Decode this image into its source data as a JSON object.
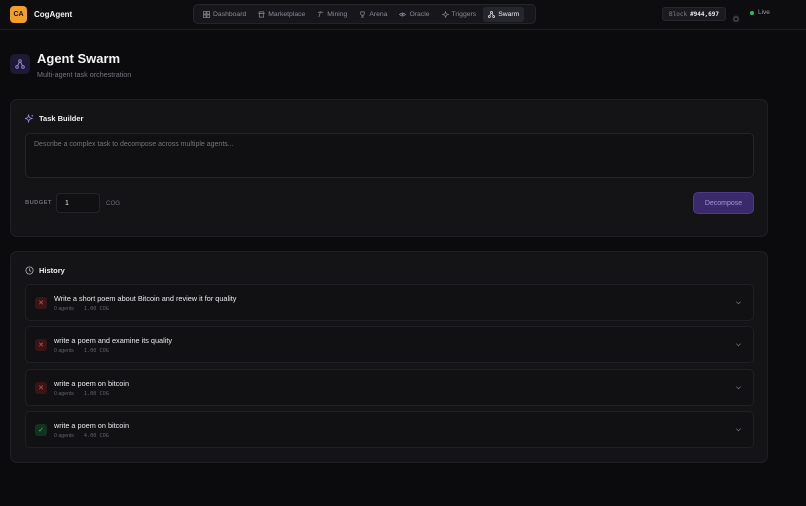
{
  "app": {
    "logo_text": "CA",
    "name": "CogAgent"
  },
  "nav": [
    {
      "label": "Dashboard",
      "icon": "grid-icon",
      "active": false
    },
    {
      "label": "Marketplace",
      "icon": "store-icon",
      "active": false
    },
    {
      "label": "Mining",
      "icon": "pickaxe-icon",
      "active": false
    },
    {
      "label": "Arena",
      "icon": "trophy-icon",
      "active": false
    },
    {
      "label": "Oracle",
      "icon": "eye-icon",
      "active": false
    },
    {
      "label": "Triggers",
      "icon": "sparkle-icon",
      "active": false
    },
    {
      "label": "Swarm",
      "icon": "network-icon",
      "active": true
    }
  ],
  "status": {
    "block_label": "Block",
    "block_value": "#944,697",
    "live_label": "Live"
  },
  "page": {
    "title": "Agent Swarm",
    "subtitle": "Multi-agent task orchestration"
  },
  "task_builder": {
    "title": "Task Builder",
    "placeholder": "Describe a complex task to decompose across multiple agents...",
    "budget_label": "BUDGET",
    "budget_value": "1",
    "budget_unit": "COG",
    "decompose_label": "Decompose"
  },
  "history": {
    "title": "History",
    "items": [
      {
        "title": "Write a short poem about Bitcoin and review it for quality",
        "agents": "0 agents",
        "cost": "1.00 COG",
        "status": "failed"
      },
      {
        "title": "write a poem and examine its quality",
        "agents": "0 agents",
        "cost": "1.00 COG",
        "status": "failed"
      },
      {
        "title": "write a poem on bitcoin",
        "agents": "0 agents",
        "cost": "1.00 COG",
        "status": "failed"
      },
      {
        "title": "write a poem on bitcoin",
        "agents": "0 agents",
        "cost": "4.00 COG",
        "status": "success"
      }
    ]
  },
  "colors": {
    "accent": "#3a2a6b",
    "brand": "#f0a02a",
    "live": "#24c06b",
    "fail": "#e05050",
    "ok": "#34c47a"
  }
}
